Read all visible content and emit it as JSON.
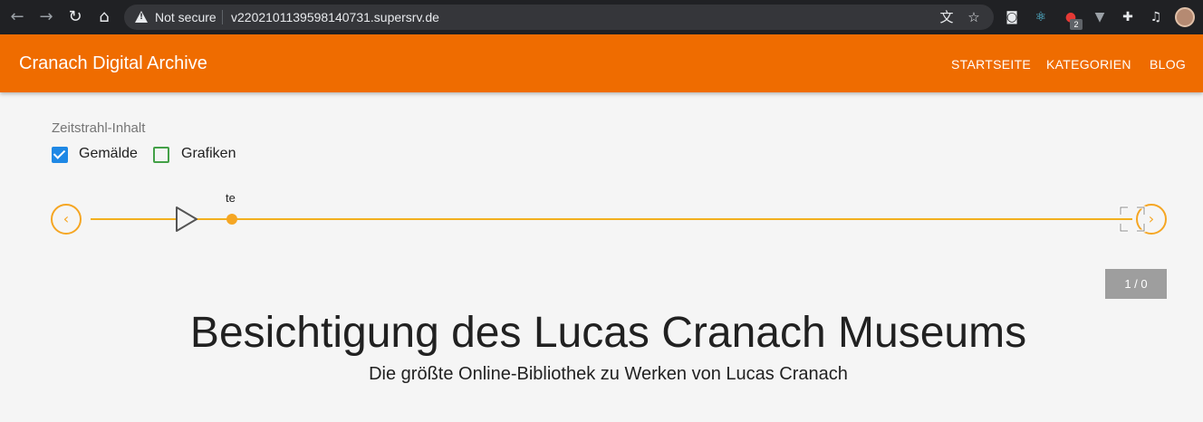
{
  "browser": {
    "security_label": "Not secure",
    "url": "v2202101139598140731.supersrv.de",
    "extension_badge": "2"
  },
  "app": {
    "title": "Cranach Digital Archive",
    "nav": [
      "STARTSEITE",
      "KATEGORIEN",
      "BLOG"
    ],
    "accent_color": "#ef6c00"
  },
  "filters": {
    "label": "Zeitstrahl-Inhalt",
    "options": [
      {
        "label": "Gemälde",
        "checked": true
      },
      {
        "label": "Grafiken",
        "checked": false
      }
    ]
  },
  "timeline": {
    "marker_label": "te",
    "color": "#f5a623"
  },
  "counter": "1 / 0",
  "hero": {
    "title": "Besichtigung des Lucas Cranach Museums",
    "subtitle": "Die größte Online-Bibliothek zu Werken von Lucas Cranach"
  }
}
